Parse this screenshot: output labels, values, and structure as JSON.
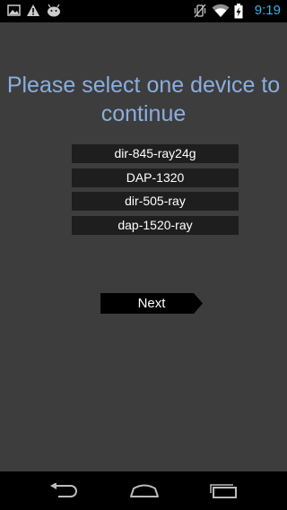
{
  "status_bar": {
    "time": "9:19",
    "left_icons": [
      "image-notification-icon",
      "warning-icon",
      "android-debug-icon"
    ],
    "right_icons": [
      "vibrate-icon",
      "wifi-icon",
      "battery-icon"
    ]
  },
  "main": {
    "title": "Please select one device to continue",
    "devices": [
      {
        "label": "dir-845-ray24g"
      },
      {
        "label": "DAP-1320"
      },
      {
        "label": "dir-505-ray"
      },
      {
        "label": "dap-1520-ray"
      }
    ],
    "next_label": "Next"
  },
  "nav_bar": {
    "buttons": [
      "back-icon",
      "home-icon",
      "recent-apps-icon"
    ]
  },
  "colors": {
    "background": "#3d3d3d",
    "title": "#8aaee0",
    "item_background": "#1e1e1e",
    "clock": "#33b5e5",
    "bars": "#000000"
  }
}
